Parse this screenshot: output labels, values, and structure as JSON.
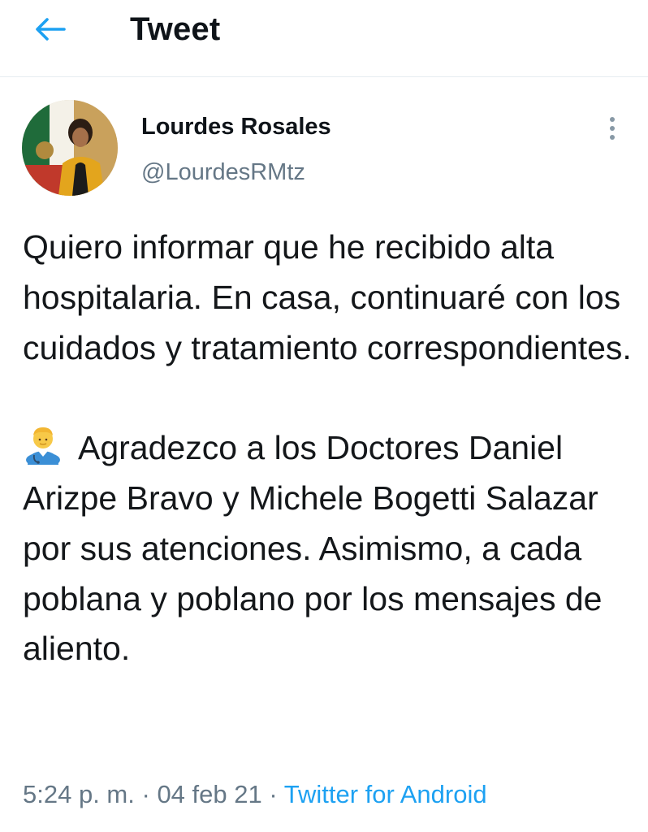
{
  "header": {
    "back_icon": "arrow-left-icon",
    "title": "Tweet",
    "accent_color": "#1da1f2"
  },
  "author": {
    "display_name": "Lourdes Rosales",
    "handle": "@LourdesRMtz",
    "avatar_icon": "profile-photo"
  },
  "tweet": {
    "paragraph_1": "Quiero informar que he recibido alta hospitalaria. En casa, continuaré con los cuidados y tratamiento correspondientes.",
    "emoji_icon": "health-worker-emoji-icon",
    "paragraph_2": "Agradezco a los Doctores Daniel Arizpe Bravo y Michele Bogetti Salazar por sus atenciones. Asimismo, a cada poblana y poblano por los mensajes de aliento."
  },
  "meta": {
    "time": "5:24 p. m.",
    "separator": "·",
    "date": "04 feb 21",
    "source": "Twitter for Android"
  },
  "more_icon": "more-vertical-icon"
}
